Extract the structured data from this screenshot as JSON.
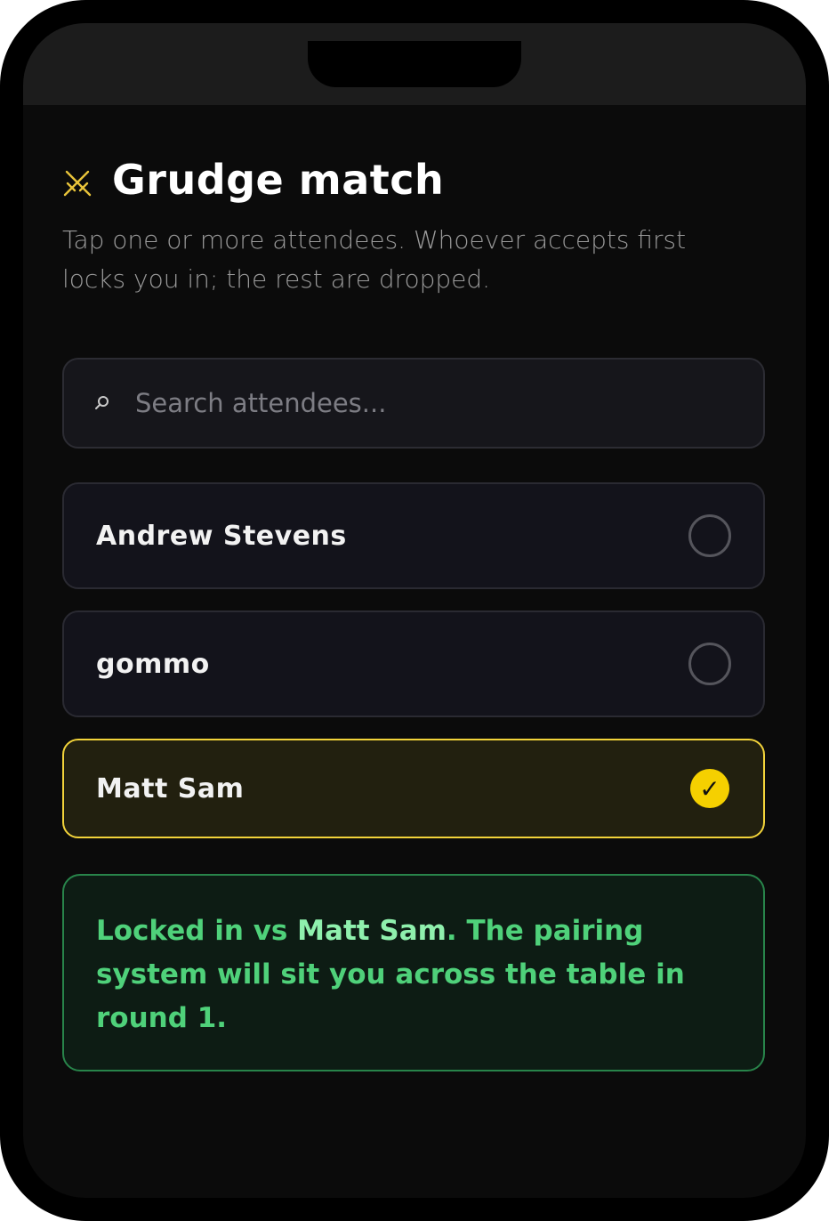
{
  "screen": {
    "title": "Grudge match",
    "title_icon": "crossed-swords-icon",
    "subtitle": "Tap one or more attendees. Whoever accepts first locks you in; the rest are dropped."
  },
  "search": {
    "placeholder": "Search attendees...",
    "value": "",
    "icon": "search-icon"
  },
  "attendees": [
    {
      "name": "Andrew Stevens",
      "selected": false
    },
    {
      "name": "gommo",
      "selected": false
    },
    {
      "name": "Matt Sam",
      "selected": true,
      "check_glyph": "✓"
    }
  ],
  "status": {
    "prefix": "Locked in vs ",
    "opponent": "Matt Sam",
    "suffix": ". The pairing system will sit you across the table in round 1."
  },
  "colors": {
    "accent_yellow": "#f5d000",
    "success_green": "#4fd17a",
    "background": "#0b0b0b"
  }
}
